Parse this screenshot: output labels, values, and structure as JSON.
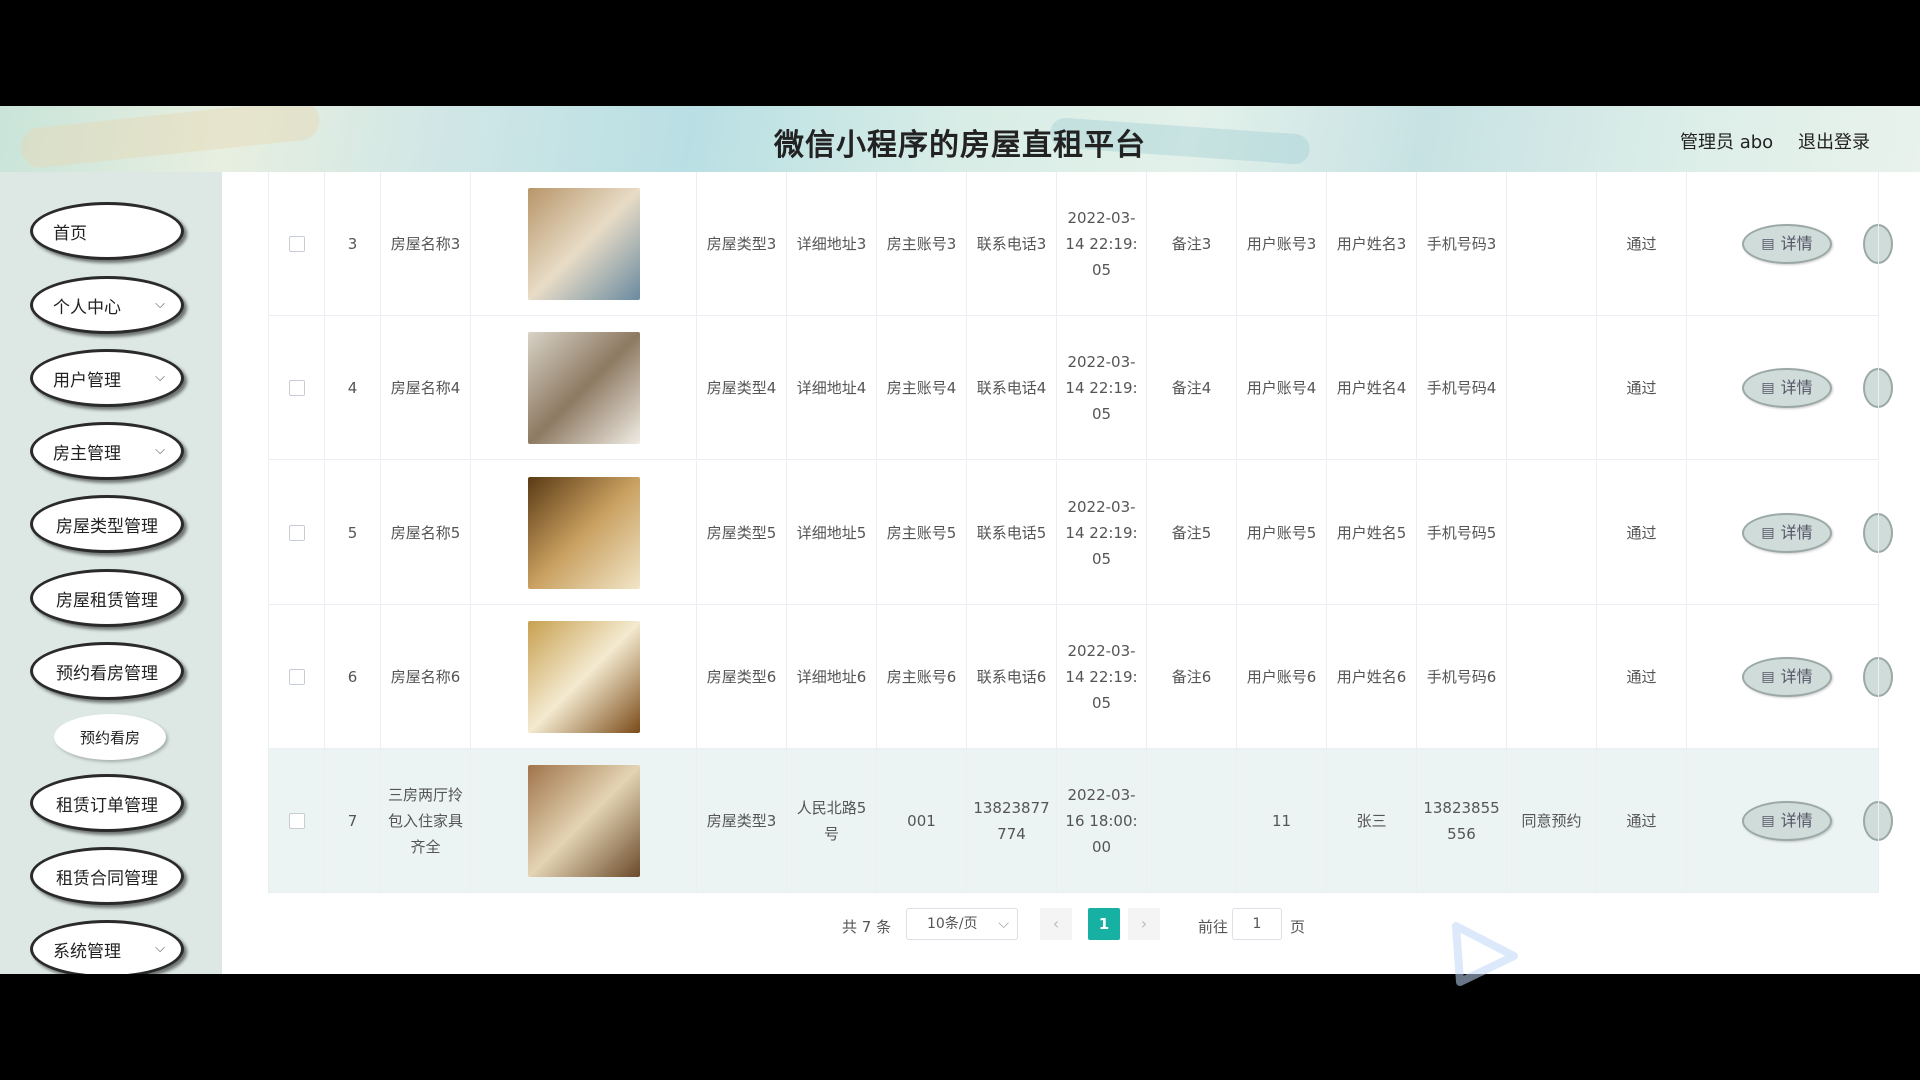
{
  "header": {
    "title": "微信小程序的房屋直租平台",
    "admin": "管理员 abo",
    "logout": "退出登录"
  },
  "sidebar": {
    "items": [
      {
        "label": "首页",
        "chev": ""
      },
      {
        "label": "个人中心",
        "chev": "⌵"
      },
      {
        "label": "用户管理",
        "chev": "⌵"
      },
      {
        "label": "房主管理",
        "chev": "⌵"
      },
      {
        "label": "房屋类型管理",
        "chev": ""
      },
      {
        "label": "房屋租赁管理",
        "chev": ""
      },
      {
        "label": "预约看房管理",
        "chev": ""
      }
    ],
    "submenu": "预约看房",
    "items2": [
      {
        "label": "租赁订单管理"
      },
      {
        "label": "租赁合同管理"
      },
      {
        "label": "系统管理",
        "chev": "⌵"
      }
    ]
  },
  "table": {
    "rows": [
      {
        "idx": "3",
        "name": "房屋名称3",
        "type": "房屋类型3",
        "addr": "详细地址3",
        "owner": "房主账号3",
        "phone": "联系电话3",
        "time": "2022-03-14 22:19:05",
        "note": "备注3",
        "uacc": "用户账号3",
        "uname": "用户姓名3",
        "umob": "手机号码3",
        "reply": "",
        "status": "通过",
        "detail": "详情"
      },
      {
        "idx": "4",
        "name": "房屋名称4",
        "type": "房屋类型4",
        "addr": "详细地址4",
        "owner": "房主账号4",
        "phone": "联系电话4",
        "time": "2022-03-14 22:19:05",
        "note": "备注4",
        "uacc": "用户账号4",
        "uname": "用户姓名4",
        "umob": "手机号码4",
        "reply": "",
        "status": "通过",
        "detail": "详情"
      },
      {
        "idx": "5",
        "name": "房屋名称5",
        "type": "房屋类型5",
        "addr": "详细地址5",
        "owner": "房主账号5",
        "phone": "联系电话5",
        "time": "2022-03-14 22:19:05",
        "note": "备注5",
        "uacc": "用户账号5",
        "uname": "用户姓名5",
        "umob": "手机号码5",
        "reply": "",
        "status": "通过",
        "detail": "详情"
      },
      {
        "idx": "6",
        "name": "房屋名称6",
        "type": "房屋类型6",
        "addr": "详细地址6",
        "owner": "房主账号6",
        "phone": "联系电话6",
        "time": "2022-03-14 22:19:05",
        "note": "备注6",
        "uacc": "用户账号6",
        "uname": "用户姓名6",
        "umob": "手机号码6",
        "reply": "",
        "status": "通过",
        "detail": "详情"
      },
      {
        "idx": "7",
        "name": "三房两厅拎包入住家具齐全",
        "type": "房屋类型3",
        "addr": "人民北路5号",
        "owner": "001",
        "phone": "13823877774",
        "time": "2022-03-16 18:00:00",
        "note": "",
        "uacc": "11",
        "uname": "张三",
        "umob": "13823855556",
        "reply": "同意预约",
        "status": "通过",
        "detail": "详情"
      }
    ]
  },
  "pager": {
    "total": "共 7 条",
    "size": "10条/页",
    "current": "1",
    "goto": "前往",
    "goto_value": "1",
    "page_unit": "页"
  },
  "colors": {
    "accent": "#16b1a3",
    "sidebar_bg": "#dde8e4"
  },
  "icons": {
    "detail": "document-icon",
    "chevron": "chevron-down-icon"
  }
}
